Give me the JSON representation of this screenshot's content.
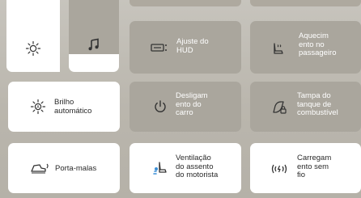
{
  "tiles": {
    "brightness": {
      "label": "",
      "icon": "sun-icon"
    },
    "media": {
      "label": "",
      "icon": "music-note-icon"
    },
    "hud": {
      "label": "Ajuste do\nHUD",
      "icon": "hud-icon"
    },
    "passenger_heat": {
      "label": "Aquecim\nento no\npassageiro",
      "icon": "seat-heat-icon"
    },
    "auto_brightness": {
      "label": "Brilho\nautomático",
      "icon": "auto-brightness-icon"
    },
    "power_off": {
      "label": "Desligam\nento do\ncarro",
      "icon": "power-icon"
    },
    "fuel_door": {
      "label": "Tampa do\ntanque de\ncombustível",
      "icon": "fuel-door-icon"
    },
    "trunk": {
      "label": "Porta-malas",
      "icon": "trunk-icon"
    },
    "driver_vent": {
      "label": "Ventilação\ndo assento\ndo motorista",
      "icon": "seat-vent-icon"
    },
    "wireless_charge": {
      "label": "Carregam\nento sem\nfio",
      "icon": "wireless-charging-icon"
    }
  },
  "colors": {
    "background": "#bdb9b1",
    "tile_active": "#ffffff",
    "tile_inactive": "#aaa69d"
  }
}
